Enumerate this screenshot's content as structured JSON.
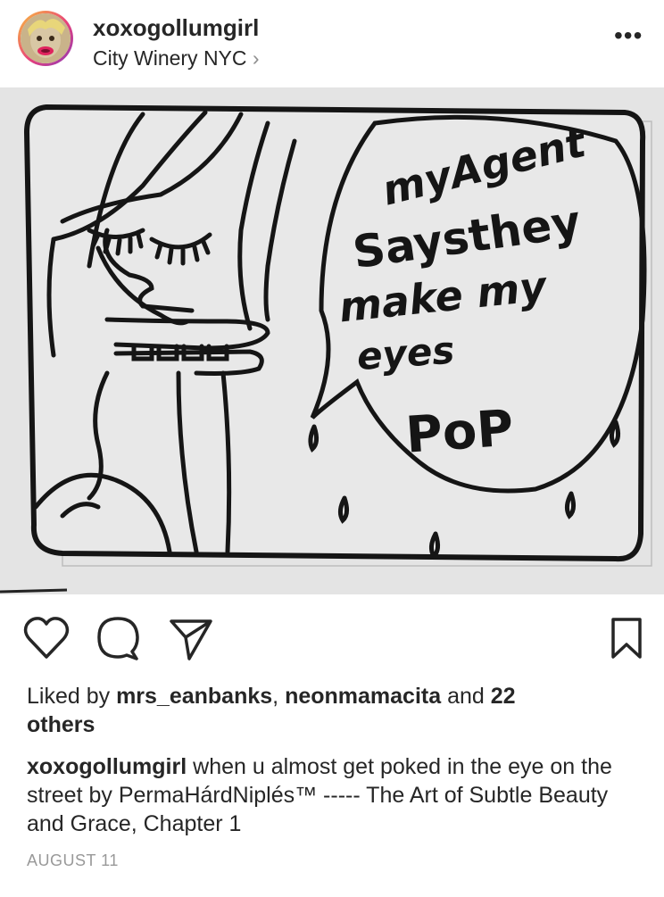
{
  "post": {
    "username": "xoxogollumgirl",
    "location": "City Winery NYC",
    "location_chevron": "›",
    "more": "•••"
  },
  "artwork_text": {
    "line1": "myAgent",
    "line2": "Saysthey",
    "line3": "make my",
    "line4": "eyes",
    "line5": "PoP"
  },
  "actions": {
    "like_icon": "heart-icon",
    "comment_icon": "comment-icon",
    "share_icon": "share-icon",
    "save_icon": "bookmark-icon"
  },
  "likes": {
    "prefix": "Liked by ",
    "user1": "mrs_eanbanks",
    "separator": ", ",
    "user2": "neonmamacita",
    "middle": " and ",
    "others_count": "22",
    "others_word": "others"
  },
  "caption": {
    "author": "xoxogollumgirl",
    "text": " when u almost get poked in the eye on the street by PermaHárdNiplés™ ----- The Art of Subtle Beauty and Grace, Chapter 1"
  },
  "date": "AUGUST 11",
  "colors": {
    "text": "#262626",
    "muted": "#999999",
    "photo_bg": "#e6e6e6"
  }
}
